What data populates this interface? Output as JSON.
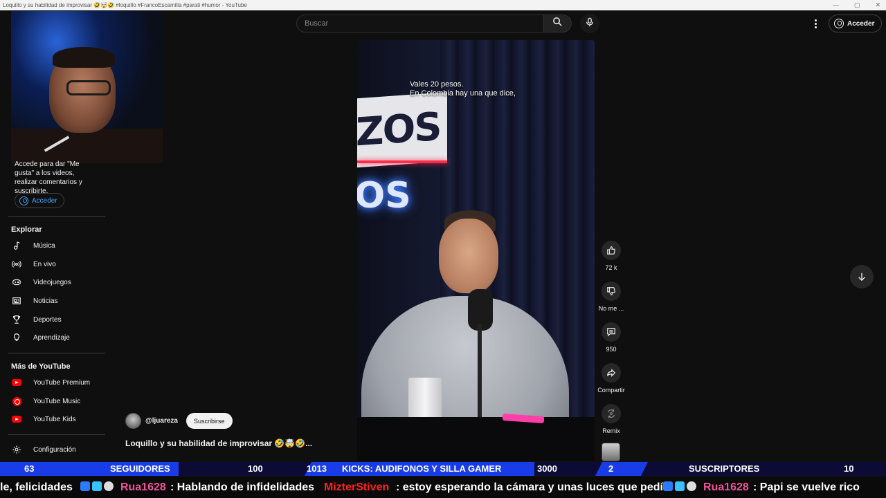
{
  "window": {
    "title": "Loquillo y su habilidad de improvisar 🤣🤯🤣 #loquillo #FrancoEscamilla #parati #humor - YouTube"
  },
  "sidebar": {
    "signin_text": "Accede para dar \"Me gusta\" a los videos, realizar comentarios y suscribirte.",
    "signin_button": "Acceder",
    "explore_title": "Explorar",
    "explore_items": [
      {
        "label": "Música",
        "icon": "music-note-icon"
      },
      {
        "label": "En vivo",
        "icon": "live-icon"
      },
      {
        "label": "Videojuegos",
        "icon": "gamepad-icon"
      },
      {
        "label": "Noticias",
        "icon": "newspaper-icon"
      },
      {
        "label": "Deportes",
        "icon": "trophy-icon"
      },
      {
        "label": "Aprendizaje",
        "icon": "lightbulb-icon"
      }
    ],
    "more_title": "Más de YouTube",
    "more_items": [
      {
        "label": "YouTube Premium",
        "icon": "youtube-premium-icon"
      },
      {
        "label": "YouTube Music",
        "icon": "youtube-music-icon"
      },
      {
        "label": "YouTube Kids",
        "icon": "youtube-kids-icon"
      }
    ],
    "settings_label": "Configuración"
  },
  "header": {
    "search_placeholder": "Buscar",
    "signin_label": "Acceder"
  },
  "video": {
    "subtitle_line1": "Vales 20 pesos.",
    "subtitle_line2": "En Colombia hay una que dice,",
    "sign_text_top": "ZOS",
    "sign_text_bottom": "OS"
  },
  "actions": {
    "like_count": "72 k",
    "dislike_label": "No me ...",
    "comments_count": "950",
    "share_label": "Compartir",
    "remix_label": "Remix"
  },
  "channel": {
    "handle": "@ljuareza",
    "subscribe_label": "Suscribirse",
    "video_title": "Loquillo y su habilidad de improvisar 🤣🤯🤣..."
  },
  "stream_goals": {
    "followers_current": "63",
    "followers_label": "SEGUIDORES",
    "followers_goal": "100",
    "kicks_current": "1013",
    "kicks_label": "KICKS: AUDIFONOS Y SILLA GAMER",
    "kicks_goal": "3000",
    "subs_current": "2",
    "subs_label": "SUSCRIPTORES",
    "subs_goal": "10"
  },
  "chat_ticker": {
    "msg1_text": "le, felicidades",
    "msg2_user": "Rua1628",
    "msg2_text": ": Hablando de infidelidades",
    "msg3_user": "MizterStiven",
    "msg3_text": ": estoy esperando la cámara y unas luces que pedí",
    "msg4_user": "Rua1628",
    "msg4_text": ": Papi se vuelve rico"
  },
  "colors": {
    "background": "#0f0f0f",
    "accent_blue": "#3ea6ff",
    "goal_fill": "#1a3ce8",
    "goal_bar": "#0b0b36",
    "chat_user": "#f0529a"
  }
}
